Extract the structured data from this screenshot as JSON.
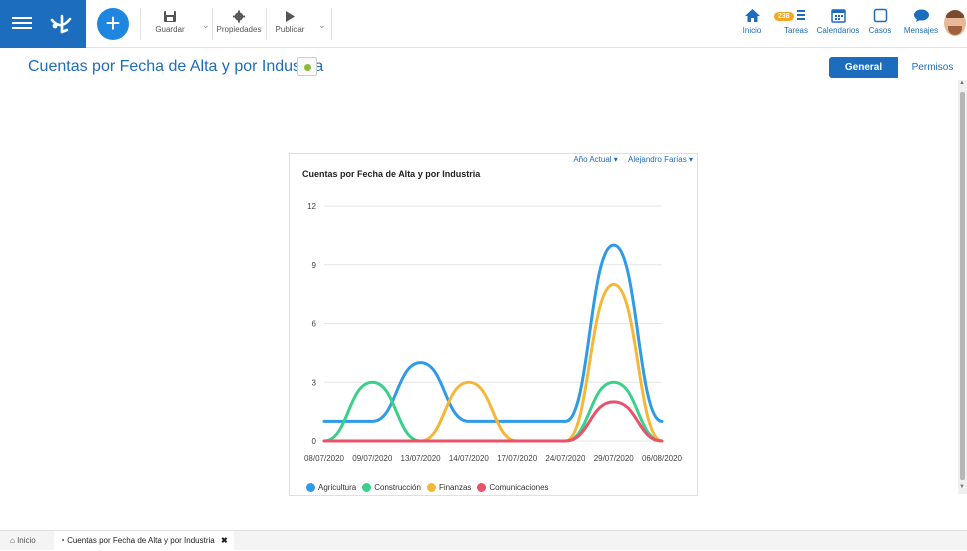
{
  "toolbar": {
    "save_label": "Guardar",
    "properties_label": "Propiedades",
    "publish_label": "Publicar"
  },
  "nav": {
    "home_label": "Inicio",
    "tasks_label": "Tareas",
    "tasks_count": "238",
    "calendars_label": "Calendarios",
    "cases_label": "Casos",
    "messages_label": "Mensajes"
  },
  "page": {
    "title": "Cuentas por Fecha de Alta y por Industria",
    "tabs": [
      {
        "label": "General",
        "active": true
      },
      {
        "label": "Permisos",
        "active": false
      }
    ]
  },
  "filters": {
    "period": "Año Actual",
    "user": "Alejandro Farías"
  },
  "chart_data": {
    "type": "line",
    "title": "Cuentas por Fecha de Alta y por Industria",
    "x": [
      "08/07/2020",
      "09/07/2020",
      "13/07/2020",
      "14/07/2020",
      "17/07/2020",
      "24/07/2020",
      "29/07/2020",
      "06/08/2020"
    ],
    "ylim": [
      0,
      12
    ],
    "yticks": [
      0,
      3,
      6,
      9,
      12
    ],
    "grid": true,
    "legend": "bottom",
    "series": [
      {
        "name": "Agricultura",
        "color": "#2f9be8",
        "values": [
          1,
          1,
          4,
          1,
          1,
          1,
          10,
          1
        ]
      },
      {
        "name": "Construcción",
        "color": "#3ad08b",
        "values": [
          0,
          3,
          0,
          0,
          0,
          0,
          3,
          0
        ]
      },
      {
        "name": "Finanzas",
        "color": "#f6b738",
        "values": [
          0,
          0,
          0,
          3,
          0,
          0,
          8,
          0
        ]
      },
      {
        "name": "Comunicaciones",
        "color": "#e9526a",
        "values": [
          0,
          0,
          0,
          0,
          0,
          0,
          2,
          0
        ]
      }
    ]
  },
  "footer": {
    "home_label": "Inicio",
    "tab_label": "Cuentas por Fecha de Alta y por Industria"
  }
}
